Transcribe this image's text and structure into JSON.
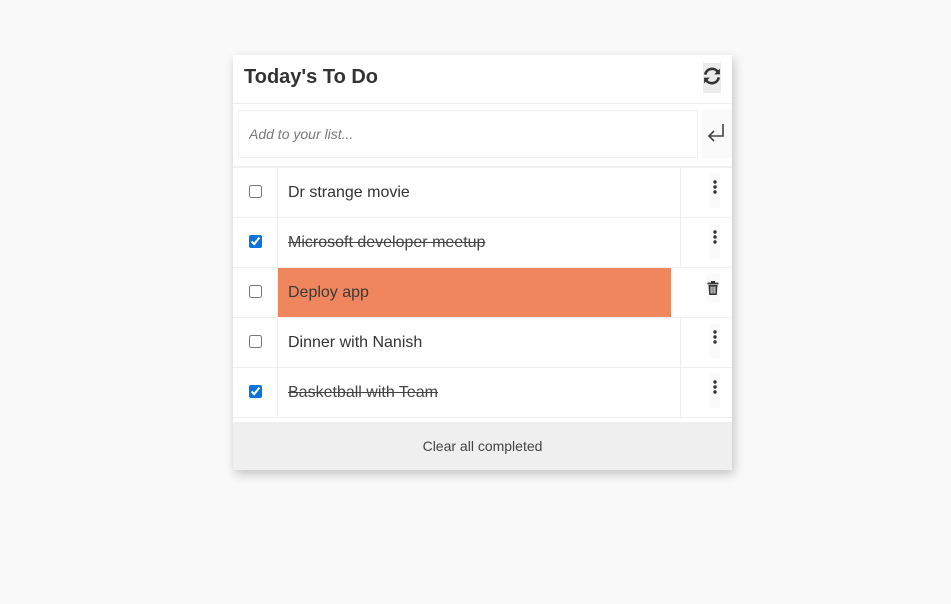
{
  "header": {
    "title": "Today's To Do",
    "refresh_icon": "refresh-icon"
  },
  "add_form": {
    "placeholder": "Add to your list...",
    "submit_icon": "enter-icon"
  },
  "todos": [
    {
      "text": "Dr strange movie",
      "completed": false,
      "highlighted": false,
      "action_icon": "more-vertical-icon"
    },
    {
      "text": "Microsoft developer meetup",
      "completed": true,
      "highlighted": false,
      "action_icon": "more-vertical-icon"
    },
    {
      "text": "Deploy app",
      "completed": false,
      "highlighted": true,
      "action_icon": "trash-icon"
    },
    {
      "text": "Dinner with Nanish",
      "completed": false,
      "highlighted": false,
      "action_icon": "more-vertical-icon"
    },
    {
      "text": "Basketball with Team",
      "completed": true,
      "highlighted": false,
      "action_icon": "more-vertical-icon"
    }
  ],
  "footer": {
    "clear_label": "Clear all completed"
  },
  "colors": {
    "highlight": "#f0865e",
    "checkbox_accent": "#0a74da",
    "footer_bg": "#efefef",
    "page_bg": "#f9f9f9"
  }
}
